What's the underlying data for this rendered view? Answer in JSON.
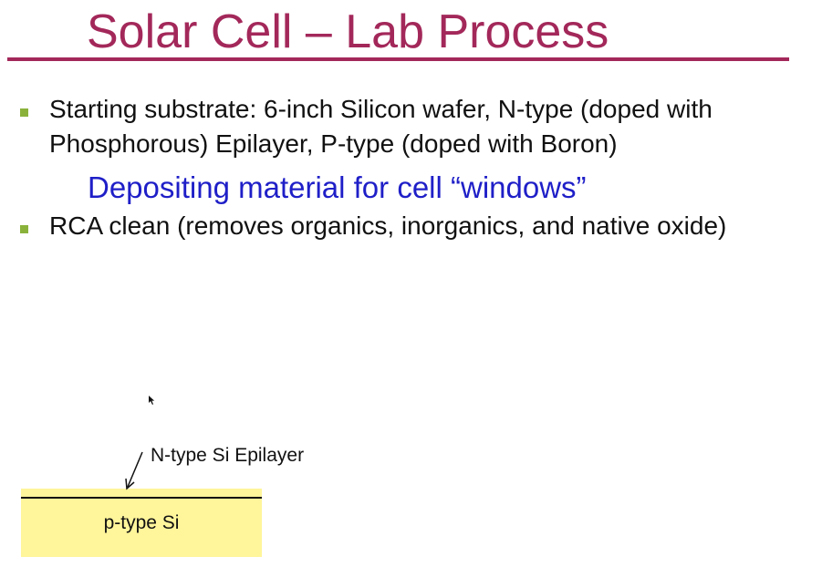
{
  "slide": {
    "title": "Solar Cell – Lab Process",
    "bullets": [
      {
        "text": "Starting substrate: 6-inch Silicon wafer, N-type (doped with Phosphorous) Epilayer, P-type (doped with Boron)"
      },
      {
        "text": "RCA clean (removes organics, inorganics, and native oxide)"
      }
    ],
    "subheading": "Depositing material for cell “windows”",
    "diagram": {
      "epilayer_label": "N-type Si Epilayer",
      "substrate_label": "p-type Si"
    }
  },
  "colors": {
    "title": "#a3285a",
    "bullet_marker": "#8ab23b",
    "subheading": "#1f1fc8",
    "substrate_fill": "#fff59b"
  },
  "icons": {
    "bullet": "square-bullet-icon",
    "pointer": "mouse-pointer-icon",
    "arrow": "arrow-down-left-icon"
  }
}
